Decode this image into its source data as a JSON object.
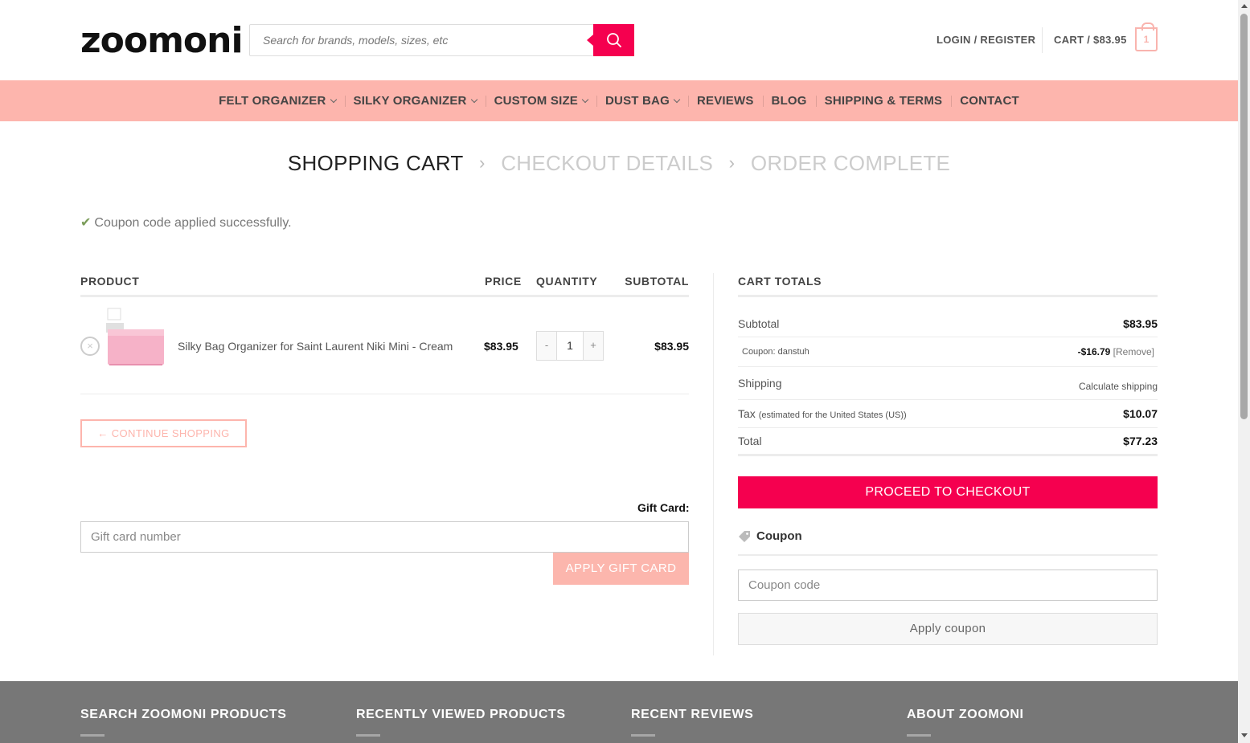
{
  "header": {
    "logo": "zoomoni",
    "search_placeholder": "Search for brands, models, sizes, etc",
    "login_label": "LOGIN / REGISTER",
    "cart_label": "CART / $83.95",
    "cart_count": "1"
  },
  "nav": {
    "items": [
      {
        "label": "FELT ORGANIZER",
        "dropdown": true
      },
      {
        "label": "SILKY ORGANIZER",
        "dropdown": true
      },
      {
        "label": "CUSTOM SIZE",
        "dropdown": true
      },
      {
        "label": "DUST BAG",
        "dropdown": true
      },
      {
        "label": "REVIEWS",
        "dropdown": false
      },
      {
        "label": "BLOG",
        "dropdown": false
      },
      {
        "label": "SHIPPING & TERMS",
        "dropdown": false
      },
      {
        "label": "CONTACT",
        "dropdown": false
      }
    ]
  },
  "steps": {
    "cart": "SHOPPING CART",
    "checkout": "CHECKOUT DETAILS",
    "complete": "ORDER COMPLETE"
  },
  "notice": "Coupon code applied successfully.",
  "cart_table": {
    "headers": {
      "product": "PRODUCT",
      "price": "PRICE",
      "quantity": "QUANTITY",
      "subtotal": "SUBTOTAL"
    },
    "rows": [
      {
        "product_name": "Silky Bag Organizer for Saint Laurent Niki Mini - Cream",
        "price": "$83.95",
        "quantity": "1",
        "subtotal": "$83.95"
      }
    ],
    "qty_minus": "-",
    "qty_plus": "+",
    "remove_symbol": "×"
  },
  "continue_shopping": "← CONTINUE SHOPPING",
  "gift_card": {
    "label": "Gift Card:",
    "placeholder": "Gift card number",
    "button": "APPLY GIFT CARD"
  },
  "totals": {
    "title": "CART TOTALS",
    "subtotal_label": "Subtotal",
    "subtotal_value": "$83.95",
    "coupon_label": "Coupon: danstuh",
    "coupon_value": "-$16.79",
    "coupon_remove": "[Remove]",
    "shipping_label": "Shipping",
    "shipping_value": "Calculate shipping",
    "tax_label": "Tax",
    "tax_note": "(estimated for the United States (US))",
    "tax_value": "$10.07",
    "total_label": "Total",
    "total_value": "$77.23",
    "checkout_button": "PROCEED TO CHECKOUT"
  },
  "coupon": {
    "heading": "Coupon",
    "placeholder": "Coupon code",
    "button": "Apply coupon"
  },
  "footer": {
    "columns": [
      "SEARCH ZOOMONI PRODUCTS",
      "RECENTLY VIEWED PRODUCTS",
      "RECENT REVIEWS",
      "ABOUT ZOOMONI"
    ]
  },
  "colors": {
    "accent": "#f5004f",
    "nav_bg": "#fdb5ad",
    "success": "#7a9c59",
    "footer_bg": "#777777"
  }
}
